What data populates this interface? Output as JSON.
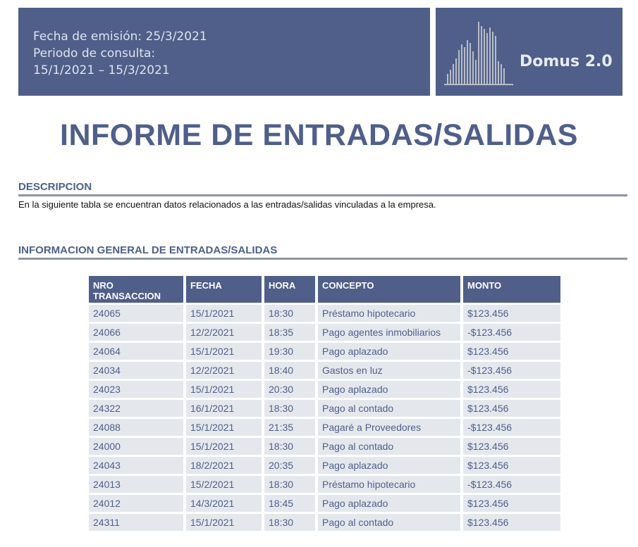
{
  "header": {
    "fecha_emision": "Fecha de emisión: 25/3/2021",
    "periodo_label": "Periodo de consulta:",
    "periodo_rango": "15/1/2021 – 15/3/2021",
    "brand": "Domus 2.0",
    "logo_icon": "building-logo-icon"
  },
  "title": "INFORME DE ENTRADAS/SALIDAS",
  "descripcion": {
    "heading": "DESCRIPCION",
    "text": "En la siguiente tabla se encuentran datos relacionados a las entradas/salidas vinculadas a la empresa."
  },
  "informacion": {
    "heading": "INFORMACION GENERAL DE ENTRADAS/SALIDAS"
  },
  "table": {
    "headers": [
      "NRO TRANSACCION",
      "FECHA",
      "HORA",
      "CONCEPTO",
      "MONTO"
    ],
    "rows": [
      [
        "24065",
        "15/1/2021",
        "18:30",
        "Préstamo hipotecario",
        "$123.456"
      ],
      [
        "24066",
        "12/2/2021",
        "18:35",
        "Pago agentes inmobiliarios",
        "-$123.456"
      ],
      [
        "24064",
        "15/1/2021",
        "19:30",
        "Pago aplazado",
        "$123.456"
      ],
      [
        "24034",
        "12/2/2021",
        "18:40",
        "Gastos en luz",
        "-$123.456"
      ],
      [
        "24023",
        "15/1/2021",
        "20:30",
        "Pago aplazado",
        "$123.456"
      ],
      [
        "24322",
        "16/1/2021",
        "18:30",
        "Pago al contado",
        "$123.456"
      ],
      [
        "24088",
        "15/1/2021",
        "21:35",
        "Pagaré a Proveedores",
        "-$123.456"
      ],
      [
        "24000",
        "15/1/2021",
        "18:30",
        "Pago al contado",
        "$123.456"
      ],
      [
        "24043",
        "18/2/2021",
        "20:35",
        "Pago aplazado",
        "$123.456"
      ],
      [
        "24013",
        "15/2/2021",
        "18:30",
        "Préstamo hipotecario",
        "-$123.456"
      ],
      [
        "24012",
        "14/3/2021",
        "18:45",
        "Pago aplazado",
        "$123.456"
      ],
      [
        "24311",
        "15/1/2021",
        "18:30",
        "Pago al contado",
        "$123.456"
      ]
    ]
  },
  "colors": {
    "primary": "#4f5f89",
    "row_bg": "#e4e8ed",
    "rule": "#8a97a6"
  }
}
